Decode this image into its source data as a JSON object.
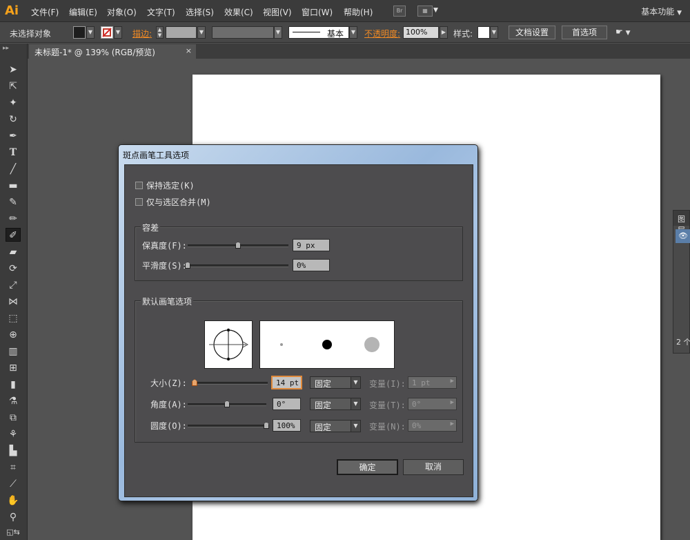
{
  "app": {
    "logo": "Ai",
    "workspace": "基本功能"
  },
  "menu": [
    "文件(F)",
    "编辑(E)",
    "对象(O)",
    "文字(T)",
    "选择(S)",
    "效果(C)",
    "视图(V)",
    "窗口(W)",
    "帮助(H)"
  ],
  "menubar_icons": {
    "bridge": "Br",
    "arrange": "arrange-documents-icon"
  },
  "control_bar": {
    "selection": "未选择对象",
    "stroke_label": "描边:",
    "stroke_style": "基本",
    "opacity_label": "不透明度:",
    "opacity_value": "100%",
    "style_label": "样式:",
    "doc_setup_button": "文档设置",
    "preferences_button": "首选项"
  },
  "document_tab": {
    "title": "未标题-1* @ 139% (RGB/预览)",
    "close": "×"
  },
  "layers_panel": {
    "header": "图层",
    "count": "2 个"
  },
  "dialog": {
    "title": "斑点画笔工具选项",
    "keep_selected": "保持选定(K)",
    "merge_selection_only": "仅与选区合并(M)",
    "tolerance_group": "容差",
    "fidelity_label": "保真度(F):",
    "fidelity_value": "9 px",
    "smoothness_label": "平滑度(S):",
    "smoothness_value": "0%",
    "brush_group": "默认画笔选项",
    "size_label": "大小(Z):",
    "size_value": "14 pt",
    "size_mode": "固定",
    "size_variation_label": "变量(I):",
    "size_variation_value": "1 pt",
    "angle_label": "角度(A):",
    "angle_value": "0°",
    "angle_mode": "固定",
    "angle_variation_label": "变量(T):",
    "angle_variation_value": "0°",
    "roundness_label": "圆度(O):",
    "roundness_value": "100%",
    "roundness_mode": "固定",
    "roundness_variation_label": "变量(N):",
    "roundness_variation_value": "0%",
    "ok_button": "确定",
    "cancel_button": "取消"
  },
  "slider_levels": {
    "fidelity": 0.5,
    "smoothness": 0.0,
    "size": 0.0,
    "angle": 0.5,
    "roundness": 1.0
  },
  "colors": {
    "accent": "#f08a24",
    "ui_dark": "#3b3b3b",
    "canvas": "#535353",
    "artboard": "#ffffff"
  }
}
